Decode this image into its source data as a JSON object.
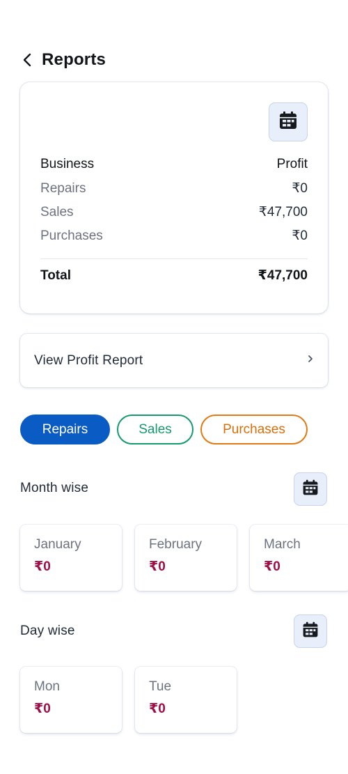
{
  "header": {
    "title": "Reports"
  },
  "summary": {
    "col_left": "Business",
    "col_right": "Profit",
    "rows": [
      {
        "label": "Repairs",
        "value": "₹0"
      },
      {
        "label": "Sales",
        "value": "₹47,700"
      },
      {
        "label": "Purchases",
        "value": "₹0"
      }
    ],
    "total_label": "Total",
    "total_value": "₹47,700"
  },
  "profit_link": {
    "label": "View Profit Report"
  },
  "filters": [
    {
      "label": "Repairs",
      "selected": true,
      "color": "#0a5bc4"
    },
    {
      "label": "Sales",
      "selected": false,
      "color": "#169a6b"
    },
    {
      "label": "Purchases",
      "selected": false,
      "color": "#e07a14"
    }
  ],
  "month_wise": {
    "title": "Month wise",
    "items": [
      {
        "label": "January",
        "value": "₹0"
      },
      {
        "label": "February",
        "value": "₹0"
      },
      {
        "label": "March",
        "value": "₹0"
      }
    ]
  },
  "day_wise": {
    "title": "Day wise",
    "items": [
      {
        "label": "Mon",
        "value": "₹0"
      },
      {
        "label": "Tue",
        "value": "₹0"
      }
    ]
  },
  "colors": {
    "accent": "#0a5bc4",
    "value_text": "#a10d45"
  },
  "icons": {
    "back": "chevron-left-icon",
    "calendar": "calendar-icon",
    "forward": "chevron-right-icon"
  }
}
